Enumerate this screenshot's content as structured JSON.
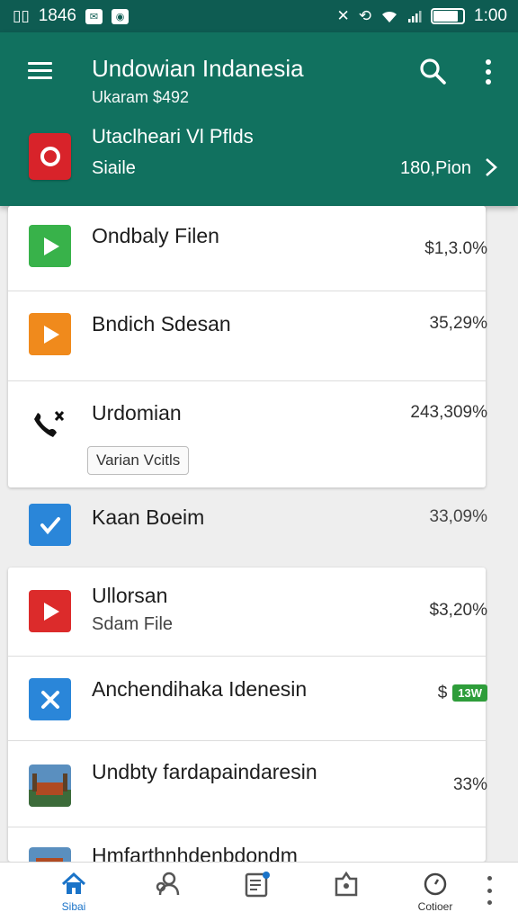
{
  "status_bar": {
    "left_text": "1846",
    "time": "1:00",
    "icons": [
      "sim-icon",
      "mail-icon",
      "camera-icon",
      "bluetooth-off-icon",
      "sync-icon",
      "wifi-icon",
      "signal-icon",
      "battery-icon"
    ],
    "battery_level": 0.85
  },
  "app_bar": {
    "title": "Undowian Indanesia",
    "subtitle": "Ukaram $492",
    "featured": {
      "title": "Utaclheari Vl Pflds",
      "subtitle": "Siaile",
      "value": "180,Pion",
      "icon_color": "#d8232a"
    },
    "background": "#11715f"
  },
  "items": [
    {
      "title": "Ondbaly Filen",
      "value": "$1,3.0%",
      "icon": "play-icon",
      "icon_color": "#38b24a"
    },
    {
      "title": "Bndich Sdesan",
      "value": "35,29%",
      "icon": "play-icon",
      "icon_color": "#f08a1c"
    },
    {
      "title": "Urdomian",
      "value": "243,309%",
      "icon": "phone-icon",
      "chip": "Varian Vcitls"
    },
    {
      "title": "Kaan Boeim",
      "value": "33,09%",
      "icon": "check-icon",
      "icon_color": "#2a86d9"
    },
    {
      "title": "Ullorsan",
      "subtitle": "Sdam File",
      "value": "$3,20%",
      "icon": "play-icon",
      "icon_color": "#dc2b2b"
    },
    {
      "title": "Anchendihaka Idenesin",
      "value": "$",
      "badge": "13W",
      "icon": "cross-icon",
      "icon_color": "#2a86d9"
    },
    {
      "title": "Undbty fardapaindaresin",
      "value": "33%",
      "icon": "photo-icon"
    },
    {
      "title": "Hmfarthnhdenbdondm",
      "value": "",
      "icon": "photo-icon"
    }
  ],
  "bottom_nav": {
    "items": [
      {
        "label": "Sibai",
        "icon": "home-icon",
        "active": true
      },
      {
        "label": "",
        "icon": "people-icon"
      },
      {
        "label": "",
        "icon": "document-icon"
      },
      {
        "label": "",
        "icon": "share-icon"
      },
      {
        "label": "Cotioer",
        "icon": "clock-icon"
      }
    ]
  }
}
